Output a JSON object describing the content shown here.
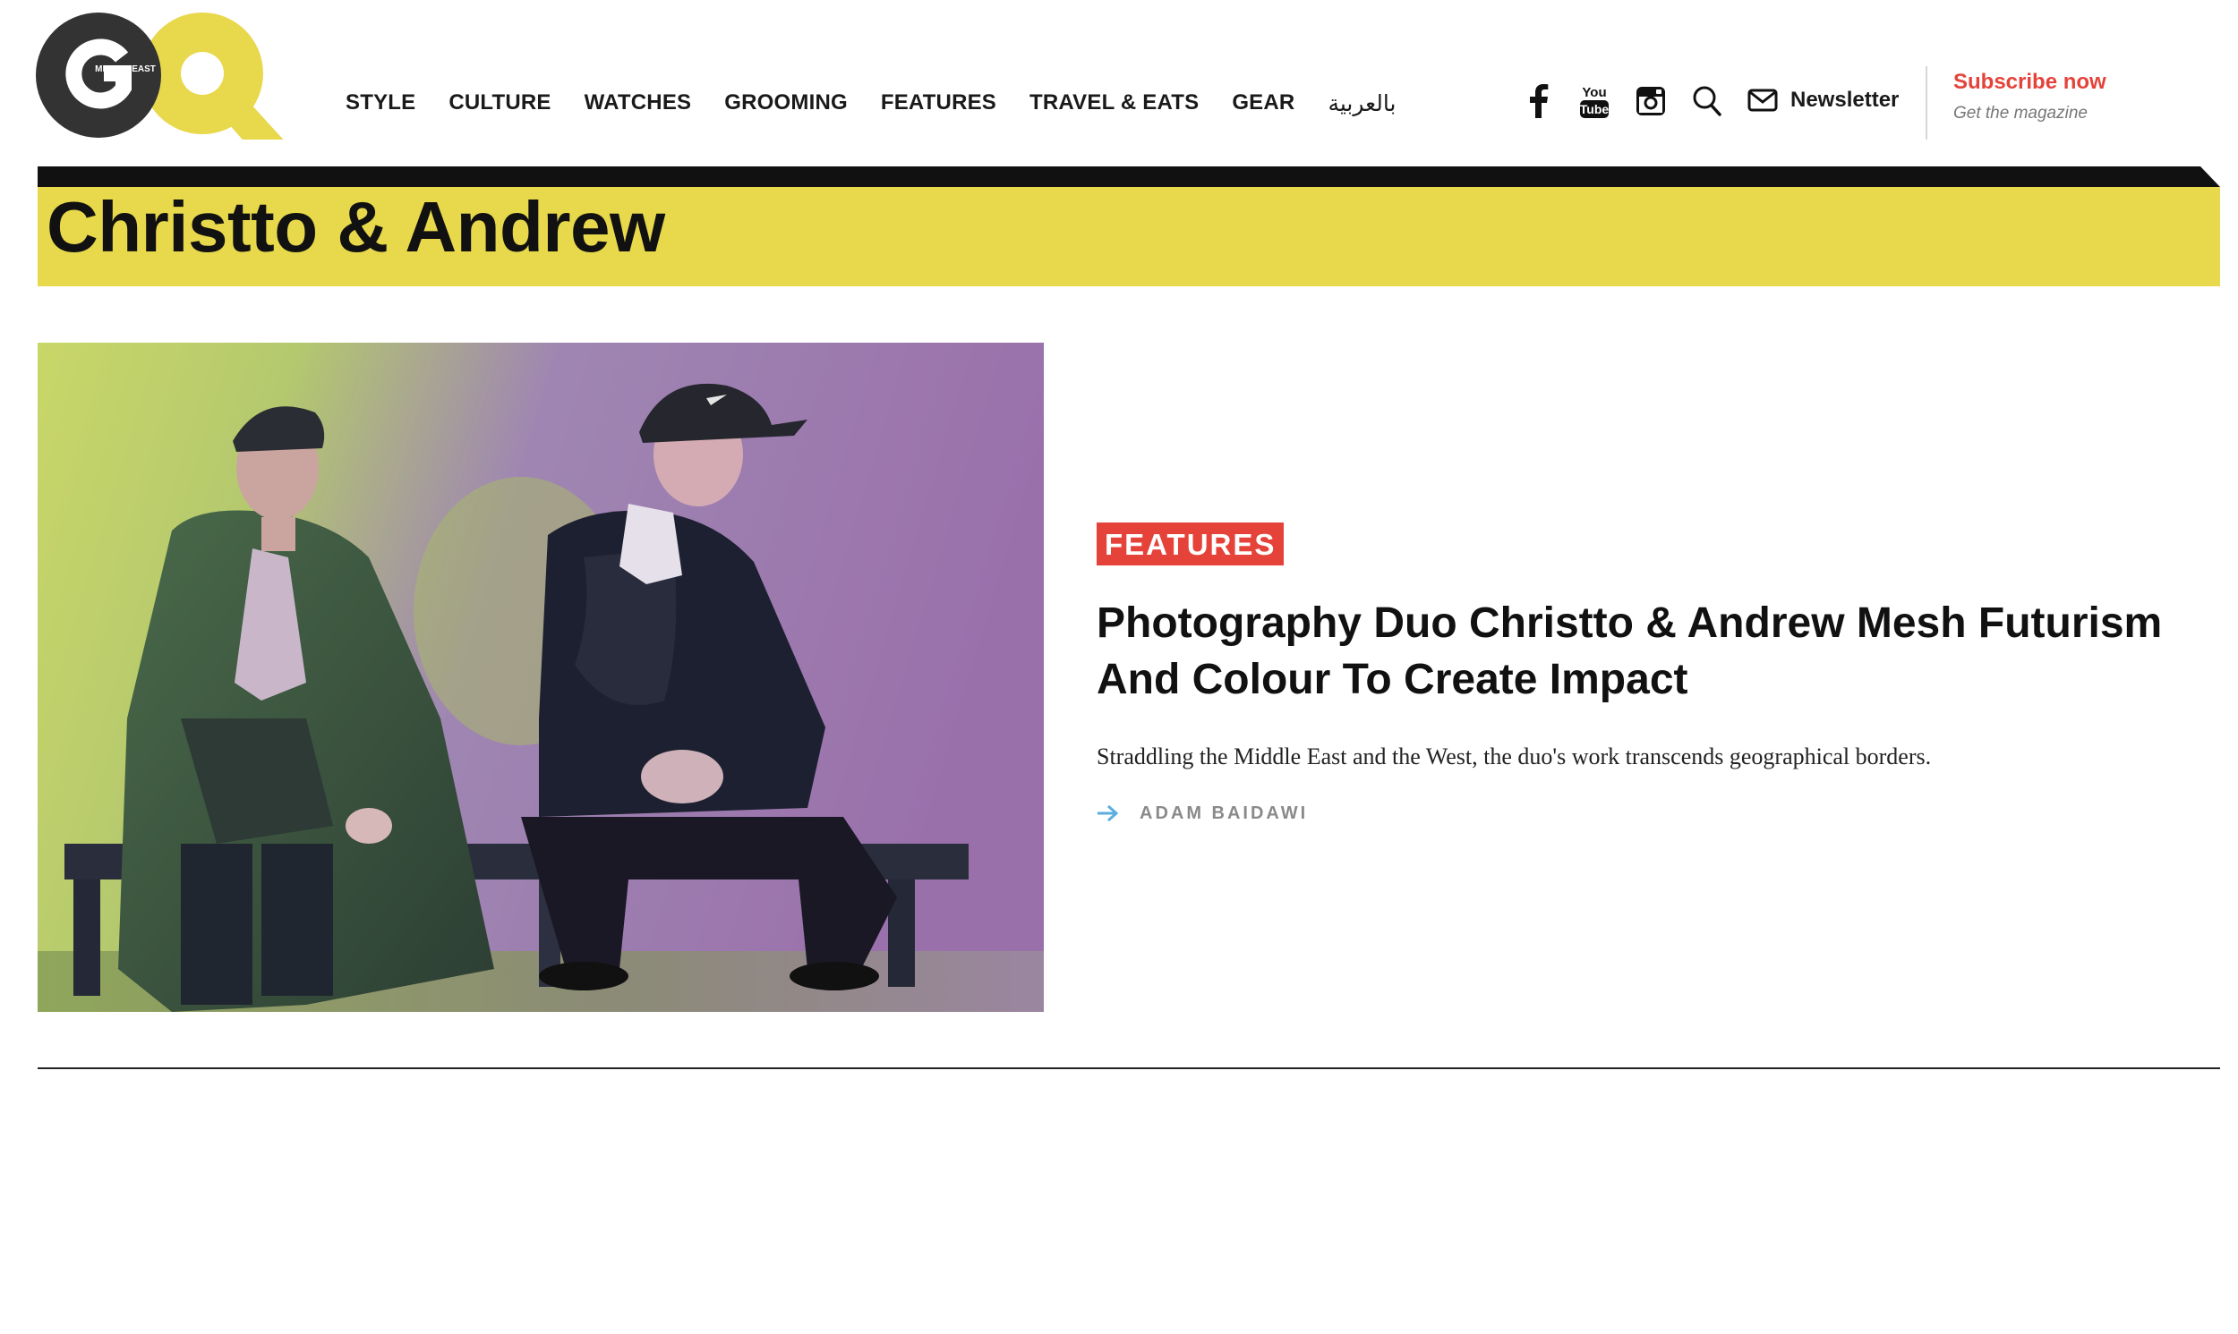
{
  "logo": {
    "text": "GQ",
    "edition": "MIDDLE EAST",
    "colors": {
      "g": "#333333",
      "q": "#e8d84b"
    }
  },
  "nav": {
    "items": [
      {
        "label": "STYLE"
      },
      {
        "label": "CULTURE"
      },
      {
        "label": "WATCHES"
      },
      {
        "label": "GROOMING"
      },
      {
        "label": "FEATURES"
      },
      {
        "label": "TRAVEL & EATS"
      },
      {
        "label": "GEAR"
      },
      {
        "label": "بالعربية"
      }
    ]
  },
  "utility": {
    "icons": [
      "facebook-icon",
      "youtube-icon",
      "instagram-icon",
      "search-icon",
      "mail-icon"
    ],
    "newsletter_label": "Newsletter",
    "subscribe_title": "Subscribe now",
    "subscribe_sub": "Get the magazine"
  },
  "page": {
    "title": "Christto & Andrew"
  },
  "article": {
    "category": "FEATURES",
    "headline": "Photography Duo Christto & Andrew Mesh Futurism And Colour To Create Impact",
    "excerpt": "Straddling the Middle East and the West, the duo's work transcends geographical borders.",
    "author": "ADAM BAIDAWI"
  },
  "colors": {
    "accent_yellow": "#e8d84b",
    "accent_red": "#e5433a",
    "byline_arrow": "#5aaee0"
  }
}
